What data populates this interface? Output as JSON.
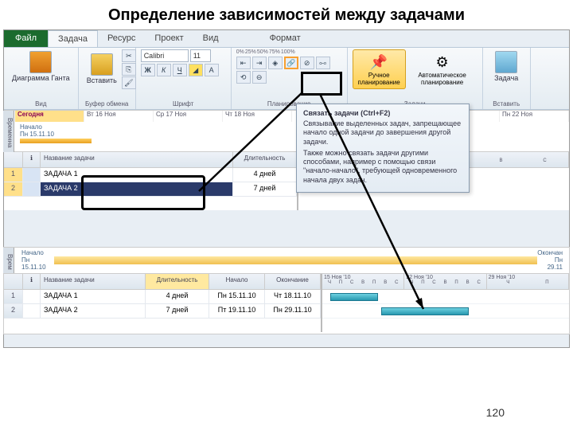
{
  "title": "Определение зависимостей между задачами",
  "page_number": "120",
  "tabs": {
    "file": "Файл",
    "task": "Задача",
    "resource": "Ресурс",
    "project": "Проект",
    "view": "Вид",
    "format": "Формат"
  },
  "ribbon": {
    "gantt": "Диаграмма\nГанта",
    "paste": "Вставить",
    "clipboard_label": "Буфер обмена",
    "font_label": "Шрифт",
    "plan_label": "Планирование",
    "tasks_label": "Задачи",
    "insert_label": "Вставить",
    "font_name": "Calibri",
    "font_size": "11",
    "zoom": [
      "0%",
      "25%",
      "50%",
      "75%",
      "100%"
    ],
    "manual": "Ручное\nпланирование",
    "auto": "Автоматическое\nпланирование",
    "task_btn": "Задача"
  },
  "tooltip": {
    "title": "Связать задачи (Ctrl+F2)",
    "p1": "Связывание выделенных задач, запрещающее начало одной задачи до завершения другой задачи.",
    "p2": "Также можно связать задачи другими способами, например с помощью связи \"начало-начало\", требующей одновременного начала двух задач."
  },
  "timeline": {
    "vlabel": "Временна",
    "today": "Сегодня",
    "days": [
      "Вт 16 Ноя",
      "Ср 17 Ноя",
      "Чт 18 Ноя",
      "",
      "",
      "Ноя",
      "Пн 22 Ноя"
    ],
    "start_label": "Начало",
    "start_date": "Пн 15.11.10"
  },
  "grid": {
    "col_name": "Название задачи",
    "col_dur": "Длительность",
    "col_start": "Начало",
    "col_end": "Окончание",
    "r1": {
      "id": "1",
      "name": "ЗАДАЧА 1",
      "dur": "4 дней",
      "start": "Пн 15.11.10",
      "end": "Чт 18.11.10"
    },
    "r2": {
      "id": "2",
      "name": "ЗАДАЧА 2",
      "dur": "7 дней",
      "start": "Пт 19.11.10",
      "end": "Пн 29.11.10"
    }
  },
  "gantt": {
    "weeks": [
      "Ноя '10",
      "22 Ноя"
    ],
    "weeks2": [
      "15 Ноя '10",
      "22 Ноя '10",
      "29 Ноя '10"
    ],
    "days_ru": "Ч П С В П В С Ч П С В П В С"
  },
  "sec2": {
    "start_label": "Начало",
    "start_date": "Пн 15.11.10",
    "end_label": "Окончан",
    "end_date": "Пн 29.11"
  }
}
